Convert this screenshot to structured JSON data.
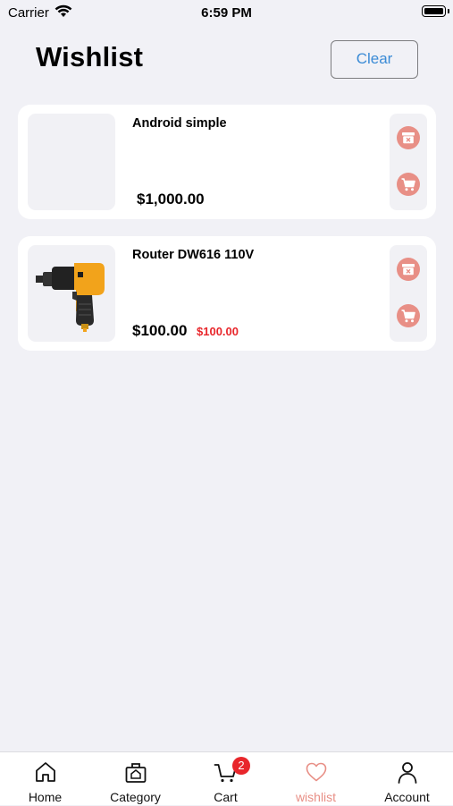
{
  "status_bar": {
    "carrier": "Carrier",
    "time": "6:59 PM"
  },
  "header": {
    "title": "Wishlist",
    "clear_label": "Clear"
  },
  "items": [
    {
      "name": "Android simple",
      "price": "$1,000.00",
      "old_price": ""
    },
    {
      "name": "Router DW616 110V",
      "price": "$100.00",
      "old_price": "$100.00"
    }
  ],
  "tab_bar": {
    "tabs": [
      {
        "label": "Home",
        "icon": "home-icon"
      },
      {
        "label": "Category",
        "icon": "category-icon"
      },
      {
        "label": "Cart",
        "icon": "cart-icon",
        "badge": "2"
      },
      {
        "label": "wishlist",
        "icon": "heart-icon"
      },
      {
        "label": "Account",
        "icon": "person-icon"
      }
    ],
    "active": "wishlist"
  },
  "colors": {
    "accent": "#e88f86",
    "link": "#3b8bd6",
    "sale": "#e8262b",
    "background": "#f1f1f6"
  }
}
